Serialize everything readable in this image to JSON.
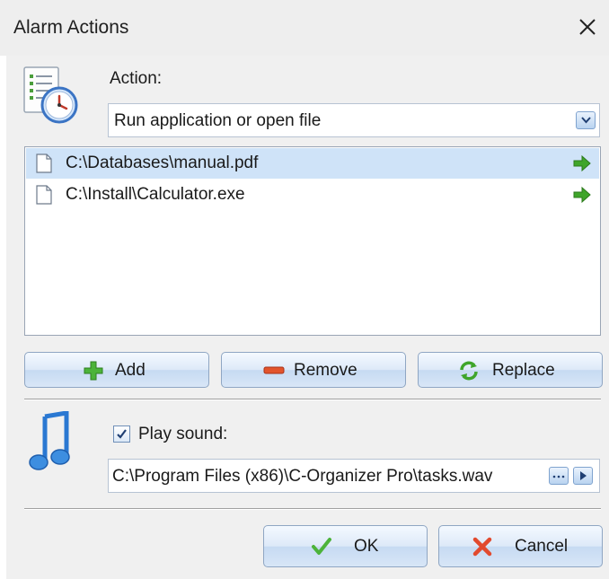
{
  "window": {
    "title": "Alarm Actions",
    "close_icon": "close-icon"
  },
  "action": {
    "label": "Action:",
    "selected": "Run application or open file",
    "icon": "alarm-clock-document-icon"
  },
  "files": [
    {
      "path": "C:\\Databases\\manual.pdf",
      "selected": true
    },
    {
      "path": "C:\\Install\\Calculator.exe",
      "selected": false
    }
  ],
  "buttons": {
    "add": "Add",
    "remove": "Remove",
    "replace": "Replace",
    "ok": "OK",
    "cancel": "Cancel"
  },
  "sound": {
    "label": "Play sound:",
    "checked": true,
    "path": "C:\\Program Files (x86)\\C-Organizer Pro\\tasks.wav",
    "icon": "music-note-icon"
  },
  "colors": {
    "selection": "#cfe3f8",
    "arrow_green": "#3fa52a",
    "add_green": "#3fa52a",
    "remove_red": "#e2542c",
    "cancel_red": "#e24a2e"
  }
}
